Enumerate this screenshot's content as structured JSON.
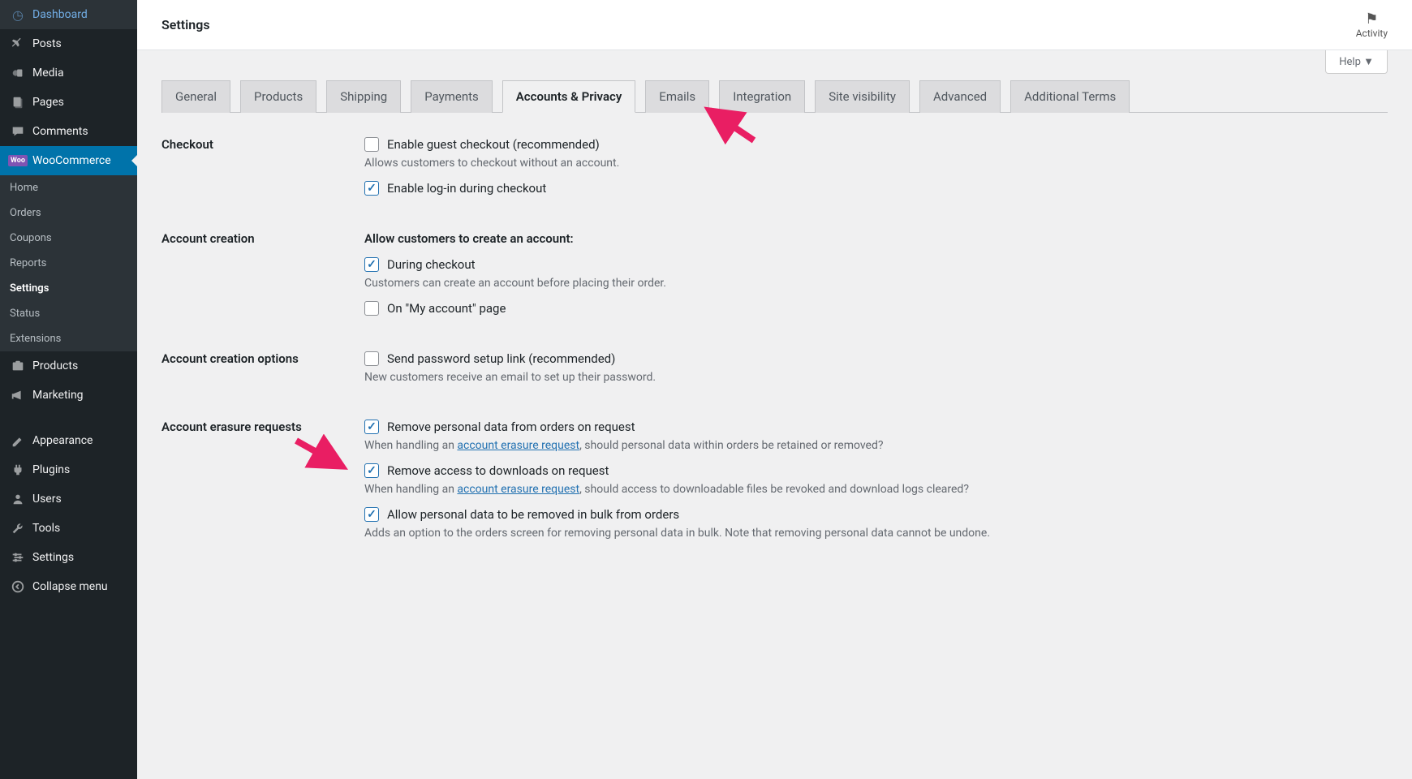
{
  "header": {
    "title": "Settings",
    "activity": "Activity",
    "help": "Help ▼"
  },
  "sidebar": {
    "items": [
      {
        "label": "Dashboard"
      },
      {
        "label": "Posts"
      },
      {
        "label": "Media"
      },
      {
        "label": "Pages"
      },
      {
        "label": "Comments"
      },
      {
        "label": "WooCommerce"
      },
      {
        "label": "Products"
      },
      {
        "label": "Marketing"
      },
      {
        "label": "Appearance"
      },
      {
        "label": "Plugins"
      },
      {
        "label": "Users"
      },
      {
        "label": "Tools"
      },
      {
        "label": "Settings"
      },
      {
        "label": "Collapse menu"
      }
    ],
    "sub": [
      {
        "label": "Home"
      },
      {
        "label": "Orders"
      },
      {
        "label": "Coupons"
      },
      {
        "label": "Reports"
      },
      {
        "label": "Settings"
      },
      {
        "label": "Status"
      },
      {
        "label": "Extensions"
      }
    ]
  },
  "tabs": [
    "General",
    "Products",
    "Shipping",
    "Payments",
    "Accounts & Privacy",
    "Emails",
    "Integration",
    "Site visibility",
    "Advanced",
    "Additional Terms"
  ],
  "activeTab": "Accounts & Privacy",
  "sections": {
    "checkout": {
      "label": "Checkout",
      "opt1": "Enable guest checkout (recommended)",
      "desc1": "Allows customers to checkout without an account.",
      "opt2": "Enable log-in during checkout"
    },
    "creation": {
      "label": "Account creation",
      "heading": "Allow customers to create an account:",
      "opt1": "During checkout",
      "desc1": "Customers can create an account before placing their order.",
      "opt2": "On \"My account\" page"
    },
    "options": {
      "label": "Account creation options",
      "opt1": "Send password setup link (recommended)",
      "desc1": "New customers receive an email to set up their password."
    },
    "erasure": {
      "label": "Account erasure requests",
      "opt1": "Remove personal data from orders on request",
      "desc1a": "When handling an ",
      "desc1_link": "account erasure request",
      "desc1b": ", should personal data within orders be retained or removed?",
      "opt2": "Remove access to downloads on request",
      "desc2a": "When handling an ",
      "desc2_link": "account erasure request",
      "desc2b": ", should access to downloadable files be revoked and download logs cleared?",
      "opt3": "Allow personal data to be removed in bulk from orders",
      "desc3": "Adds an option to the orders screen for removing personal data in bulk. Note that removing personal data cannot be undone."
    }
  }
}
